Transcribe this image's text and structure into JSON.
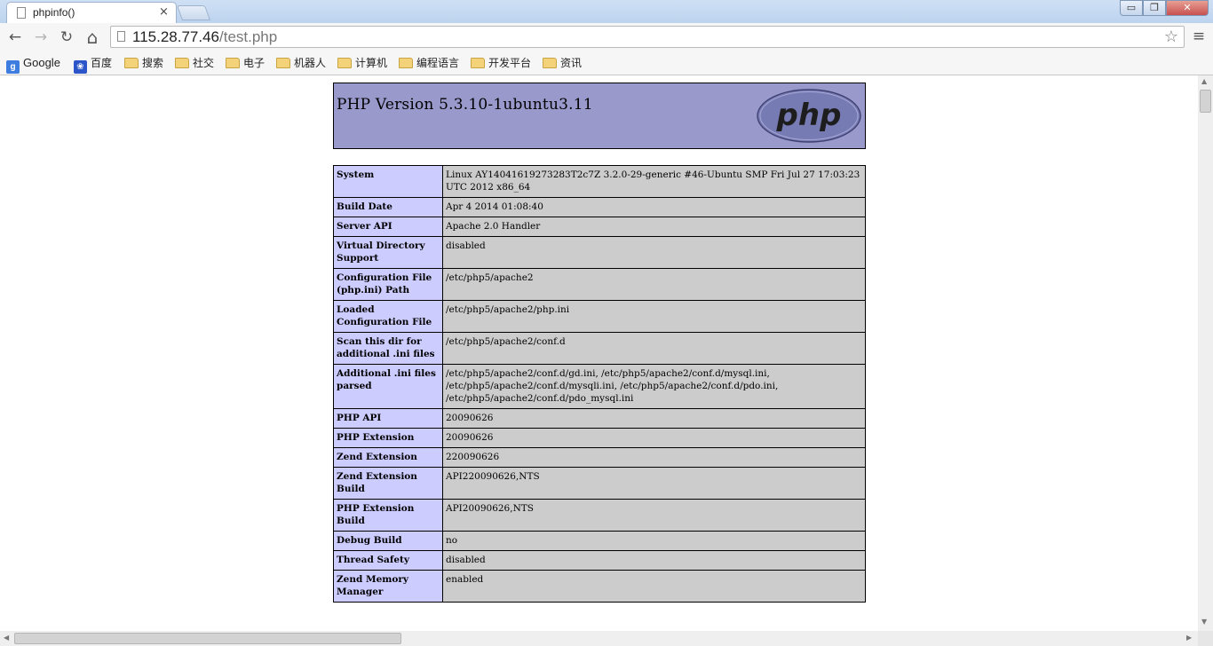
{
  "browser": {
    "tab_title": "phpinfo()",
    "tab_close": "×",
    "url_host": "115.28.77.46",
    "url_path": "/test.php",
    "window_min": "▭",
    "window_max": "❐",
    "window_close": "✕"
  },
  "nav": {
    "back": "←",
    "forward": "→",
    "reload": "↻",
    "home": "⌂",
    "star": "☆",
    "menu": "≡"
  },
  "bookmarks": [
    {
      "label": "Google",
      "icon": "google-icon"
    },
    {
      "label": "百度",
      "icon": "baidu-icon"
    },
    {
      "label": "搜索",
      "icon": "folder-icon"
    },
    {
      "label": "社交",
      "icon": "folder-icon"
    },
    {
      "label": "电子",
      "icon": "folder-icon"
    },
    {
      "label": "机器人",
      "icon": "folder-icon"
    },
    {
      "label": "计算机",
      "icon": "folder-icon"
    },
    {
      "label": "编程语言",
      "icon": "folder-icon"
    },
    {
      "label": "开发平台",
      "icon": "folder-icon"
    },
    {
      "label": "资讯",
      "icon": "folder-icon"
    }
  ],
  "phpinfo": {
    "title": "PHP Version 5.3.10-1ubuntu3.11",
    "logo_text": "php",
    "rows": [
      {
        "key": "System",
        "value": "Linux AY14041619273283T2c7Z 3.2.0-29-generic #46-Ubuntu SMP Fri Jul 27 17:03:23 UTC 2012 x86_64"
      },
      {
        "key": "Build Date",
        "value": "Apr 4 2014 01:08:40"
      },
      {
        "key": "Server API",
        "value": "Apache 2.0 Handler"
      },
      {
        "key": "Virtual Directory Support",
        "value": "disabled"
      },
      {
        "key": "Configuration File (php.ini) Path",
        "value": "/etc/php5/apache2"
      },
      {
        "key": "Loaded Configuration File",
        "value": "/etc/php5/apache2/php.ini"
      },
      {
        "key": "Scan this dir for additional .ini files",
        "value": "/etc/php5/apache2/conf.d"
      },
      {
        "key": "Additional .ini files parsed",
        "value": "/etc/php5/apache2/conf.d/gd.ini, /etc/php5/apache2/conf.d/mysql.ini, /etc/php5/apache2/conf.d/mysqli.ini, /etc/php5/apache2/conf.d/pdo.ini, /etc/php5/apache2/conf.d/pdo_mysql.ini"
      },
      {
        "key": "PHP API",
        "value": "20090626"
      },
      {
        "key": "PHP Extension",
        "value": "20090626"
      },
      {
        "key": "Zend Extension",
        "value": "220090626"
      },
      {
        "key": "Zend Extension Build",
        "value": "API220090626,NTS"
      },
      {
        "key": "PHP Extension Build",
        "value": "API20090626,NTS"
      },
      {
        "key": "Debug Build",
        "value": "no"
      },
      {
        "key": "Thread Safety",
        "value": "disabled"
      },
      {
        "key": "Zend Memory Manager",
        "value": "enabled"
      }
    ]
  }
}
